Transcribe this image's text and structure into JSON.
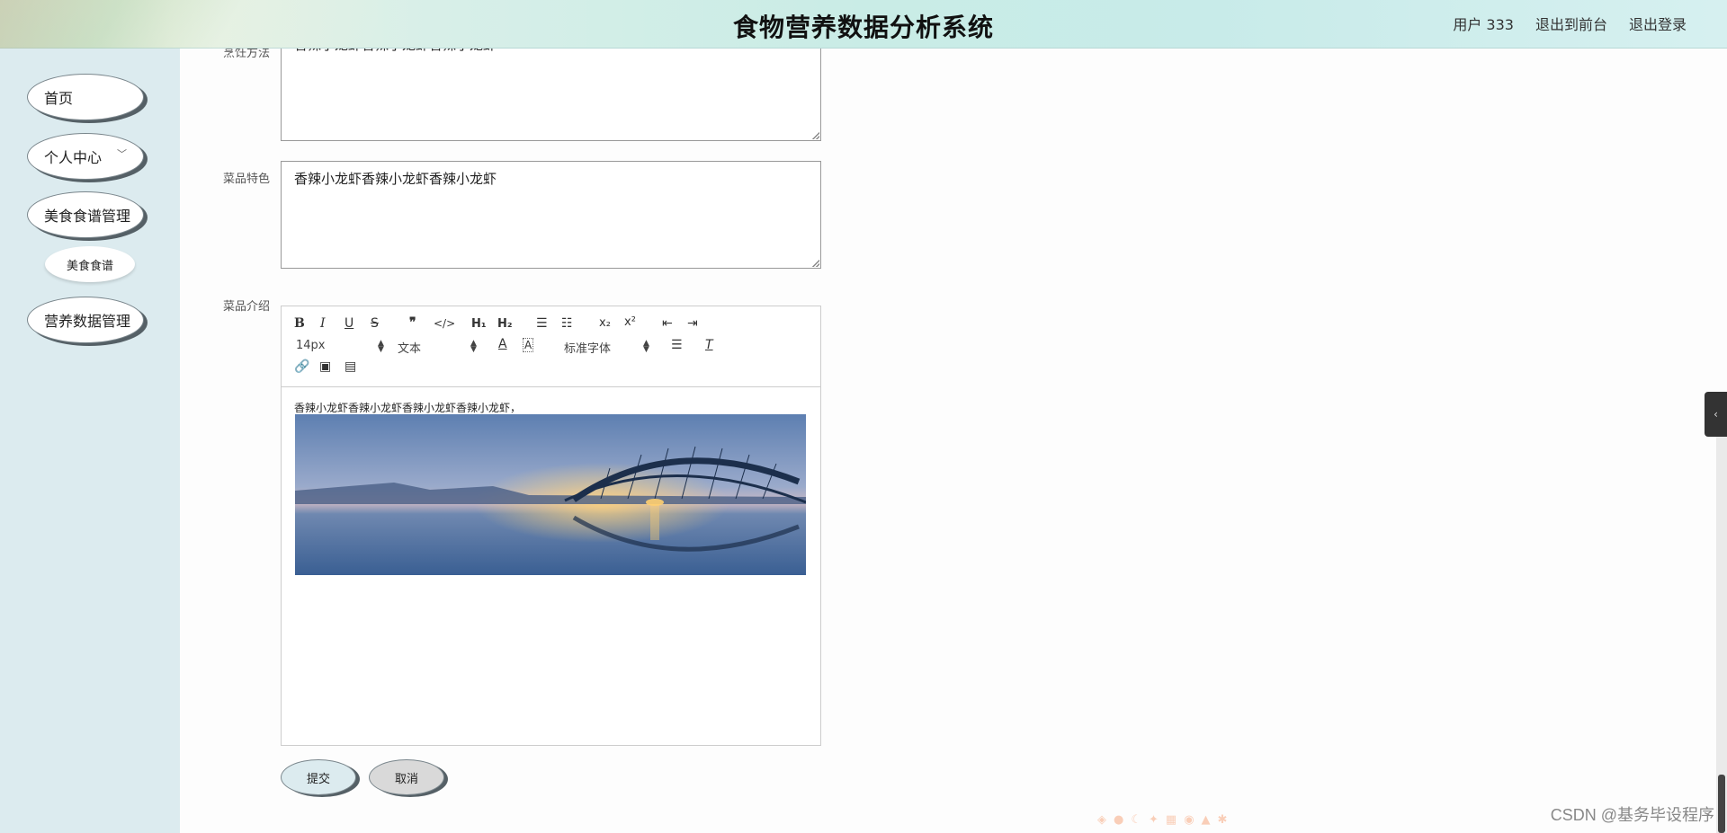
{
  "header": {
    "title": "食物营养数据分析系统",
    "user": "用户 333",
    "back_front": "退出到前台",
    "logout": "退出登录"
  },
  "sidebar": {
    "items": [
      {
        "label": "首页"
      },
      {
        "label": "个人中心"
      },
      {
        "label": "美食食谱管理"
      },
      {
        "label": "美食食谱"
      },
      {
        "label": "营养数据管理"
      }
    ]
  },
  "form": {
    "cook_method": {
      "label": "烹饪方法",
      "value": "香辣小龙虾香辣小龙虾香辣小龙虾"
    },
    "feature": {
      "label": "菜品特色",
      "value": "香辣小龙虾香辣小龙虾香辣小龙虾"
    },
    "intro": {
      "label": "菜品介绍",
      "text": "香辣小龙虾香辣小龙虾香辣小龙虾香辣小龙虾，"
    }
  },
  "editor": {
    "size_select": "14px",
    "header_select": "文本",
    "font_select": "标准字体"
  },
  "buttons": {
    "submit": "提交",
    "cancel": "取消"
  },
  "watermark": "CSDN @基务毕设程序",
  "colors": {
    "sidebar_bg": "#dcebef",
    "header_bg": "#c9ece6",
    "submit_bg": "#dcebef",
    "cancel_bg": "#d9d9d9"
  }
}
